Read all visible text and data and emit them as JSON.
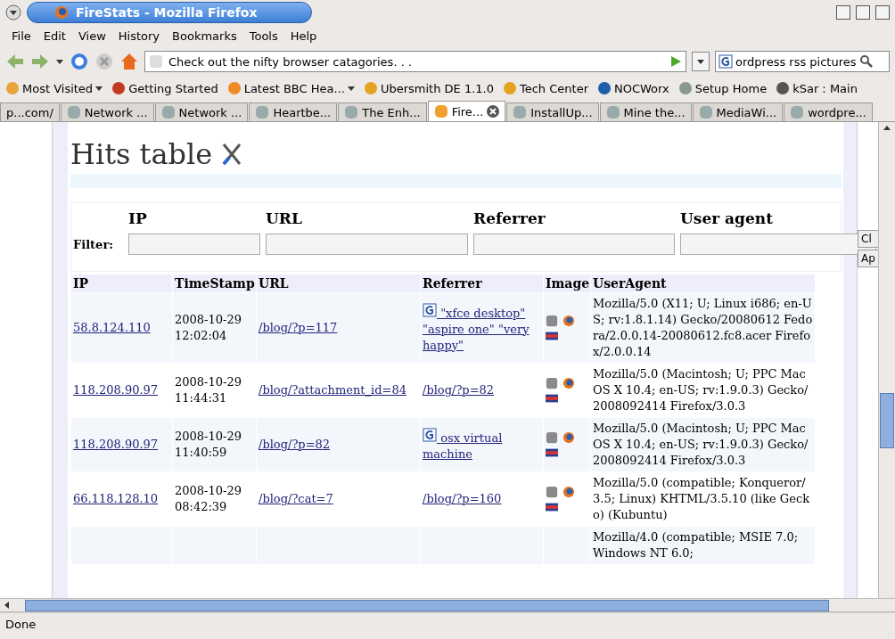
{
  "window": {
    "title": "FireStats - Mozilla Firefox"
  },
  "menu": [
    "File",
    "Edit",
    "View",
    "History",
    "Bookmarks",
    "Tools",
    "Help"
  ],
  "navigation": {
    "address": "Check out the nifty browser catagories. . .",
    "search": "ordpress rss pictures"
  },
  "bookmarks": [
    {
      "label": "Most Visited",
      "menu": true
    },
    {
      "label": "Getting Started",
      "menu": false
    },
    {
      "label": "Latest BBC Hea...",
      "menu": true
    },
    {
      "label": "Ubersmith DE 1.1.0",
      "menu": false
    },
    {
      "label": "Tech Center",
      "menu": false
    },
    {
      "label": "NOCWorx",
      "menu": false
    },
    {
      "label": "Setup Home",
      "menu": false
    },
    {
      "label": "kSar : Main",
      "menu": false
    }
  ],
  "tabs": [
    {
      "label": "p...com/",
      "selected": false
    },
    {
      "label": "Network ...",
      "selected": false
    },
    {
      "label": "Network ...",
      "selected": false
    },
    {
      "label": "Heartbe...",
      "selected": false
    },
    {
      "label": "The Enh...",
      "selected": false
    },
    {
      "label": "Fire...",
      "selected": true
    },
    {
      "label": "InstallUp...",
      "selected": false
    },
    {
      "label": "Mine the...",
      "selected": false
    },
    {
      "label": "MediaWi...",
      "selected": false
    },
    {
      "label": "wordpre...",
      "selected": false
    }
  ],
  "page": {
    "heading": "Hits table",
    "filter": {
      "columns": [
        "IP",
        "URL",
        "Referrer",
        "User agent"
      ],
      "label": "Filter:",
      "buttons": [
        "Cl",
        "Ap"
      ]
    },
    "table": {
      "columns": [
        "IP",
        "TimeStamp",
        "URL",
        "Referrer",
        "Image",
        "UserAgent"
      ],
      "rows": [
        {
          "ip": "58.8.124.110",
          "timestamp": "2008-10-29 12:02:04",
          "url": "/blog/?p=117",
          "referrer": {
            "kind": "search",
            "text": "\"xfce desktop\" \"aspire one\" \"very happy\""
          },
          "user_agent": "Mozilla/5.0 (X11; U; Linux i686; en-US; rv:1.8.1.14) Gecko/20080612 Fedora/2.0.0.14-20080612.fc8.acer Firefox/2.0.0.14"
        },
        {
          "ip": "118.208.90.97",
          "timestamp": "2008-10-29 11:44:31",
          "url": "/blog/?attachment_id=84",
          "referrer": {
            "kind": "link",
            "text": "/blog/?p=82"
          },
          "user_agent": "Mozilla/5.0 (Macintosh; U; PPC Mac OS X 10.4; en-US; rv:1.9.0.3) Gecko/2008092414 Firefox/3.0.3"
        },
        {
          "ip": "118.208.90.97",
          "timestamp": "2008-10-29 11:40:59",
          "url": "/blog/?p=82",
          "referrer": {
            "kind": "search",
            "text": "osx virtual machine"
          },
          "user_agent": "Mozilla/5.0 (Macintosh; U; PPC Mac OS X 10.4; en-US; rv:1.9.0.3) Gecko/2008092414 Firefox/3.0.3"
        },
        {
          "ip": "66.118.128.10",
          "timestamp": "2008-10-29 08:42:39",
          "url": "/blog/?cat=7",
          "referrer": {
            "kind": "link",
            "text": "/blog/?p=160"
          },
          "user_agent": "Mozilla/5.0 (compatible; Konqueror/3.5; Linux) KHTML/3.5.10 (like Gecko) (Kubuntu)"
        },
        {
          "user_agent": "Mozilla/4.0 (compatible; MSIE 7.0; Windows NT 6.0;"
        }
      ]
    }
  },
  "status_bar": "Done"
}
